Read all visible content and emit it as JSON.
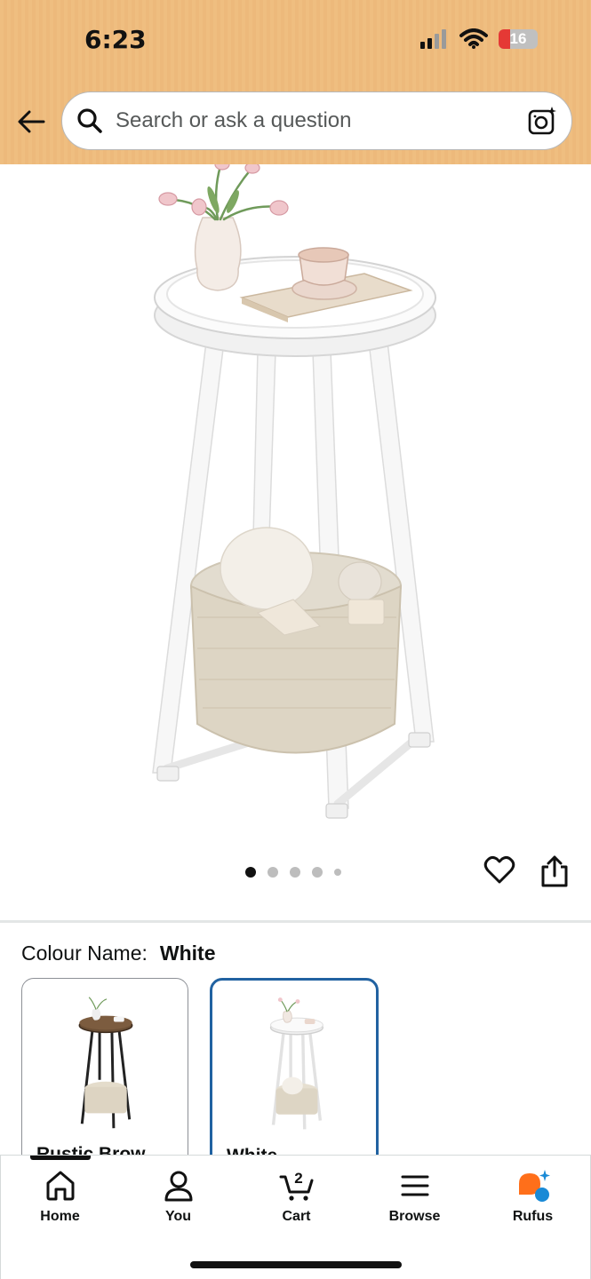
{
  "status": {
    "time": "6:23",
    "battery": "16",
    "icons": [
      "signal-icon",
      "wifi-icon",
      "battery-icon"
    ]
  },
  "search": {
    "placeholder": "Search or ask a question",
    "icons": [
      "back-arrow-icon",
      "search-icon",
      "camera-search-icon"
    ]
  },
  "gallery": {
    "dot_count": 5,
    "active_index": 0,
    "icons": [
      "heart-icon",
      "share-icon"
    ]
  },
  "colour": {
    "label": "Colour Name:",
    "selected": "White",
    "options": [
      {
        "name": "Rustic Brow"
      },
      {
        "name": "White"
      }
    ]
  },
  "nav": {
    "items": [
      {
        "label": "Home",
        "icon": "home-icon"
      },
      {
        "label": "You",
        "icon": "person-icon"
      },
      {
        "label": "Cart",
        "icon": "cart-icon",
        "badge": "2"
      },
      {
        "label": "Browse",
        "icon": "menu-icon"
      },
      {
        "label": "Rufus",
        "icon": "rufus-icon"
      }
    ]
  },
  "colors": {
    "header_bg": "#efbe80",
    "selected_border": "#2162a1",
    "rufus_orange": "#ff6f1a",
    "rufus_blue": "#1a8ad6"
  }
}
